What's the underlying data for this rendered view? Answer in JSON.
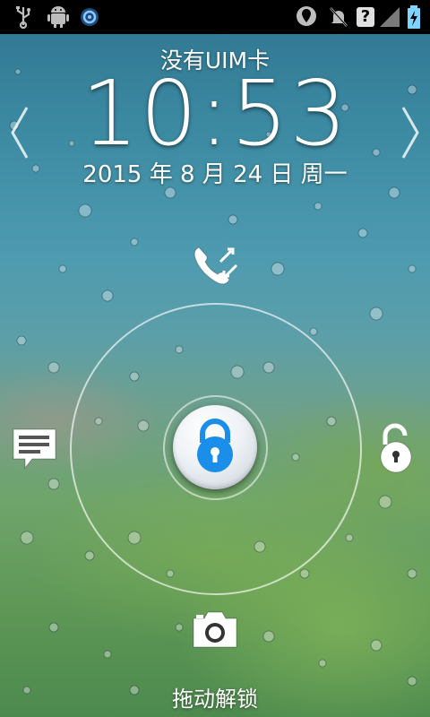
{
  "status_bar": {
    "left_icons": [
      "usb-icon",
      "android-debug-icon",
      "sync-icon"
    ],
    "right_icons": [
      "location-icon",
      "mute-icon",
      "no-sim-icon",
      "signal-icon",
      "battery-charging-icon"
    ],
    "no_sim_glyph": "?"
  },
  "lockscreen": {
    "carrier_text": "没有UIM卡",
    "time": "10:53",
    "date": "2015 年 8 月 24 日 周一",
    "unlock_hint": "拖动解锁"
  },
  "targets": {
    "top": "phone-messages-icon",
    "left": "message-icon",
    "right": "unlock-icon",
    "bottom": "camera-icon"
  },
  "colors": {
    "accent_blue": "#1a8ee8",
    "ring": "#ffffff"
  }
}
